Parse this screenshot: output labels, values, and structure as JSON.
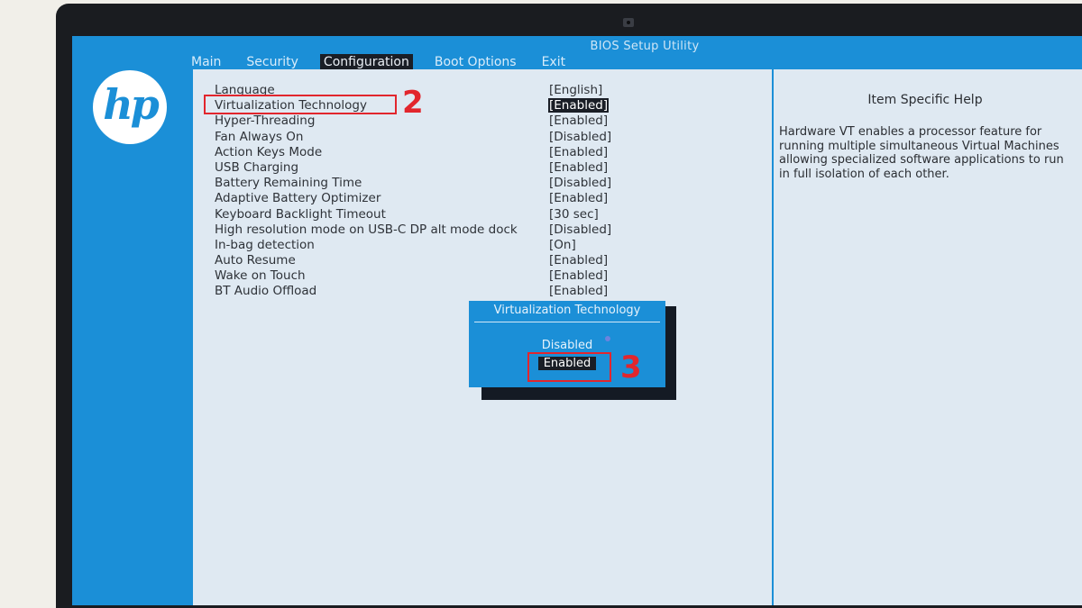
{
  "bios": {
    "title": "BIOS Setup Utility",
    "logo_text": "hp",
    "menu": [
      {
        "label": "Main"
      },
      {
        "label": "Security"
      },
      {
        "label": "Configuration"
      },
      {
        "label": "Boot Options"
      },
      {
        "label": "Exit"
      }
    ],
    "active_menu": "Configuration",
    "settings": [
      {
        "label": "Language",
        "value": "[English]"
      },
      {
        "label": "Virtualization Technology",
        "value": "[Enabled]"
      },
      {
        "label": "Hyper-Threading",
        "value": "[Enabled]"
      },
      {
        "label": "Fan Always On",
        "value": "[Disabled]"
      },
      {
        "label": "Action Keys Mode",
        "value": "[Enabled]"
      },
      {
        "label": "USB Charging",
        "value": "[Enabled]"
      },
      {
        "label": "Battery Remaining Time",
        "value": "[Disabled]"
      },
      {
        "label": "Adaptive Battery Optimizer",
        "value": "[Enabled]"
      },
      {
        "label": "Keyboard Backlight Timeout",
        "value": "[30 sec]"
      },
      {
        "label": "High resolution mode on USB-C DP alt mode dock",
        "value": "[Disabled]"
      },
      {
        "label": "In-bag detection",
        "value": "[On]"
      },
      {
        "label": "Auto Resume",
        "value": "[Enabled]"
      },
      {
        "label": "Wake on Touch",
        "value": "[Enabled]"
      },
      {
        "label": "BT Audio Offload",
        "value": "[Enabled]"
      }
    ],
    "help": {
      "title": "Item Specific Help",
      "text": "Hardware VT enables a processor feature for running multiple simultaneous Virtual Machines allowing specialized software applications to run in full isolation of each other."
    },
    "popup": {
      "title": "Virtualization Technology",
      "options": [
        "Disabled",
        "Enabled"
      ],
      "selected": "Enabled"
    }
  },
  "annotations": {
    "step2": "2",
    "step3": "3",
    "color": "#e2262d"
  },
  "colors": {
    "bios_blue": "#1b8fd7",
    "panel": "#dfe9f2",
    "highlight": "#1a1e26"
  }
}
